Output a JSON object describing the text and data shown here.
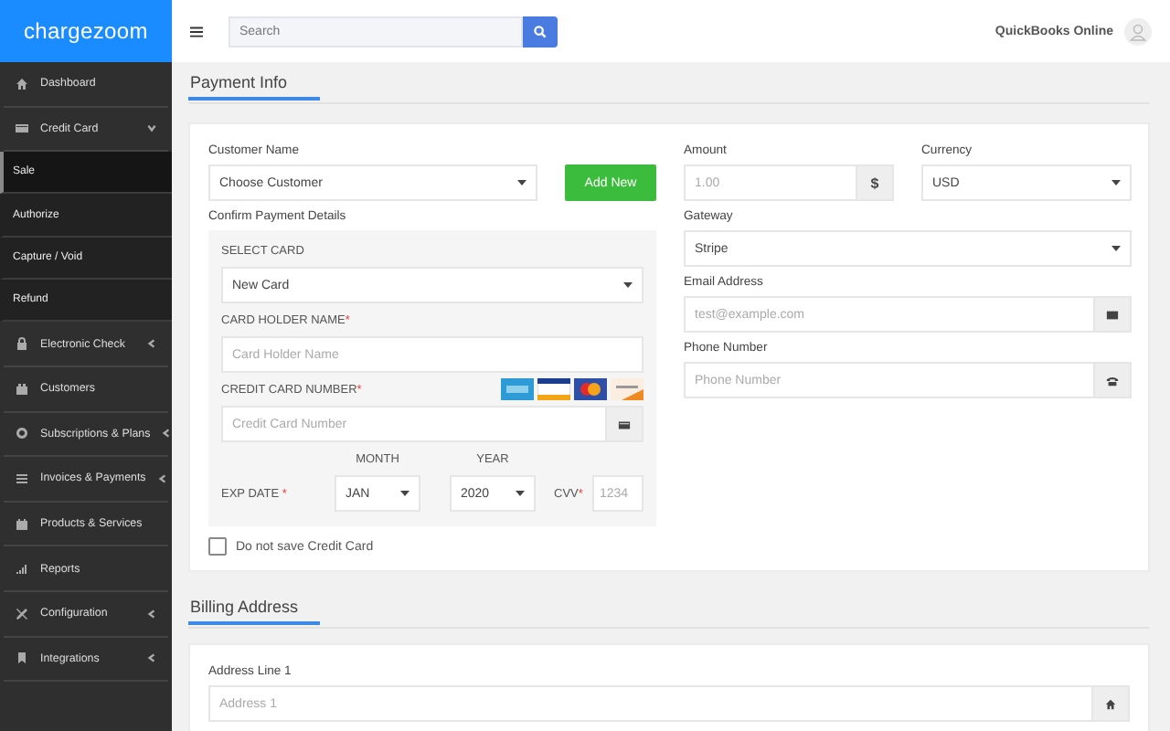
{
  "logo": "chargezoom",
  "topbar": {
    "search": {
      "placeholder": "Search"
    },
    "account": "QuickBooks Online"
  },
  "sidebar": {
    "items": [
      {
        "label": "Dashboard",
        "kind": "link",
        "selected": false
      },
      {
        "label": "Credit Card",
        "kind": "group",
        "expanded": true,
        "selected": false,
        "children": [
          {
            "label": "Sale",
            "selected": true
          },
          {
            "label": "Authorize",
            "selected": false
          },
          {
            "label": "Capture / Void",
            "selected": false
          },
          {
            "label": "Refund",
            "selected": false
          }
        ]
      },
      {
        "label": "Electronic Check",
        "kind": "group",
        "expanded": false,
        "selected": false
      },
      {
        "label": "Customers",
        "kind": "link",
        "selected": false
      },
      {
        "label": "Subscriptions & Plans",
        "kind": "group",
        "expanded": false,
        "selected": false
      },
      {
        "label": "Invoices & Payments",
        "kind": "group",
        "expanded": false,
        "selected": false
      },
      {
        "label": "Products & Services",
        "kind": "link",
        "selected": false
      },
      {
        "label": "Reports",
        "kind": "link",
        "selected": false
      },
      {
        "label": "Configuration",
        "kind": "group",
        "expanded": false,
        "selected": false
      },
      {
        "label": "Integrations",
        "kind": "group",
        "expanded": false,
        "selected": false
      }
    ]
  },
  "payment_info": {
    "title": "Payment Info",
    "customer": {
      "label": "Customer Name",
      "value": "Choose Customer",
      "button": "Add New"
    },
    "confirm_label": "Confirm Payment Details",
    "card_panel": {
      "select_label": "SELECT CARD",
      "select_value": "New Card",
      "holder_label": "CARD HOLDER NAME",
      "holder_mark": "*",
      "holder_placeholder": "Card Holder Name",
      "number_label": "CREDIT CARD NUMBER",
      "number_mark": "*",
      "number_placeholder": "Credit Card Number",
      "exp_label": "EXP DATE",
      "exp_mark": "*",
      "month_label": "MONTH",
      "month_value": "JAN",
      "year_label": "YEAR",
      "year_value": "2020",
      "cvv_label": "CVV",
      "cvv_mark": "*",
      "cvv_placeholder": "1234"
    },
    "save_card": {
      "label": "Do not save Credit Card",
      "checked": false
    },
    "amount": {
      "label": "Amount",
      "placeholder": "1.00",
      "addon": "$"
    },
    "currency": {
      "label": "Currency",
      "value": "USD"
    },
    "gateway": {
      "label": "Gateway",
      "value": "Stripe"
    },
    "email": {
      "label": "Email Address",
      "placeholder": "test@example.com"
    },
    "phone": {
      "label": "Phone Number",
      "placeholder": "Phone Number"
    }
  },
  "billing_address": {
    "title": "Billing Address",
    "address1": {
      "label": "Address Line 1",
      "placeholder": "Address 1"
    }
  }
}
